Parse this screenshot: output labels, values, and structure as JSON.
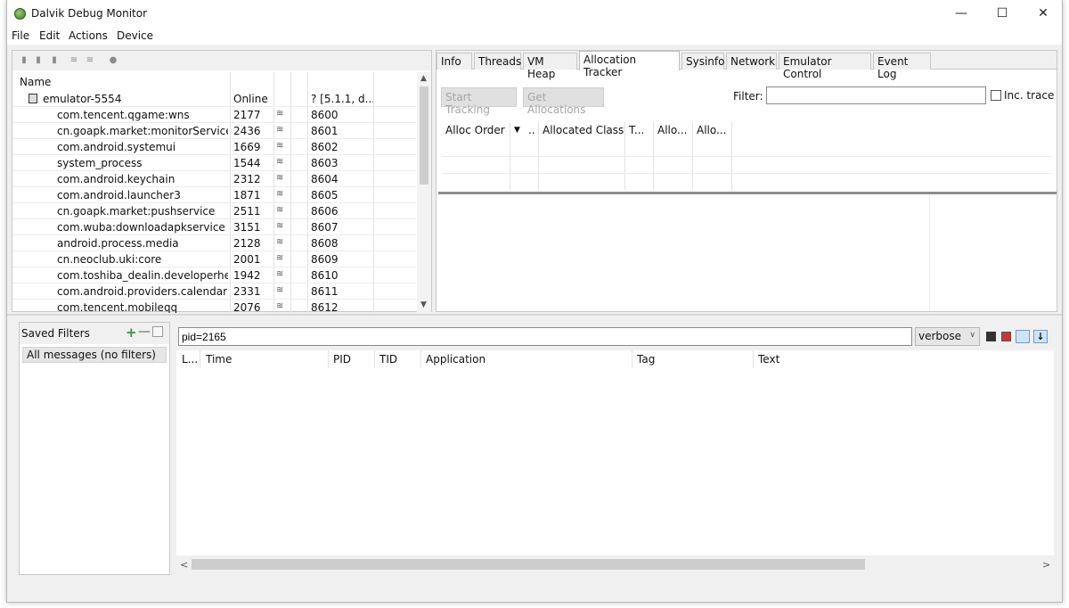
{
  "window": {
    "title": "Dalvik Debug Monitor",
    "controls": {
      "minimize": "—",
      "maximize": "☐",
      "close": "✕"
    }
  },
  "menu": [
    "File",
    "Edit",
    "Actions",
    "Device"
  ],
  "devices": {
    "column_name": "Name",
    "emulator": {
      "name": "emulator-5554",
      "status": "Online",
      "version": "? [5.1.1, d..."
    },
    "processes": [
      {
        "name": "com.tencent.qgame:wns",
        "pid": "2177",
        "port": "8600"
      },
      {
        "name": "cn.goapk.market:monitorService",
        "pid": "2436",
        "port": "8601"
      },
      {
        "name": "com.android.systemui",
        "pid": "1669",
        "port": "8602"
      },
      {
        "name": "system_process",
        "pid": "1544",
        "port": "8603"
      },
      {
        "name": "com.android.keychain",
        "pid": "2312",
        "port": "8604"
      },
      {
        "name": "com.android.launcher3",
        "pid": "1871",
        "port": "8605"
      },
      {
        "name": "cn.goapk.market:pushservice",
        "pid": "2511",
        "port": "8606"
      },
      {
        "name": "com.wuba:downloadapkservice",
        "pid": "3151",
        "port": "8607"
      },
      {
        "name": "android.process.media",
        "pid": "2128",
        "port": "8608"
      },
      {
        "name": "cn.neoclub.uki:core",
        "pid": "2001",
        "port": "8609"
      },
      {
        "name": "com.toshiba_dealin.developerhelp",
        "pid": "1942",
        "port": "8610"
      },
      {
        "name": "com.android.providers.calendar",
        "pid": "2331",
        "port": "8611"
      },
      {
        "name": "com.tencent.mobileqq",
        "pid": "2076",
        "port": "8612"
      }
    ]
  },
  "tabs": [
    "Info",
    "Threads",
    "VM Heap",
    "Allocation Tracker",
    "Sysinfo",
    "Network",
    "Emulator Control",
    "Event Log"
  ],
  "allocation": {
    "start_tracking": "Start Tracking",
    "get_allocations": "Get Allocations",
    "filter_label": "Filter:",
    "inc_trace": "Inc. trace",
    "columns": [
      "Alloc Order",
      "..",
      "Allocated Class",
      "T...",
      "Allo...",
      "Allo..."
    ]
  },
  "saved_filters": {
    "title": "Saved Filters",
    "add": "+",
    "remove": "—",
    "item": "All messages (no filters)"
  },
  "logcat": {
    "search_value": "pid=2165",
    "level": "verbose",
    "columns": [
      "L...",
      "Time",
      "PID",
      "TID",
      "Application",
      "Tag",
      "Text"
    ]
  }
}
